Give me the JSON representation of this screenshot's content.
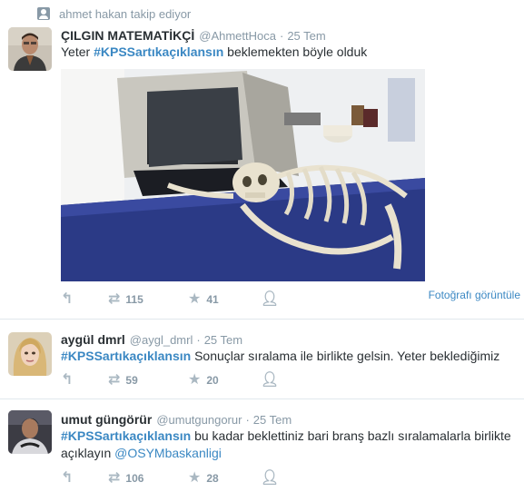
{
  "context": {
    "text": "ahmet hakan takip ediyor",
    "icon": "user-icon"
  },
  "tweets": [
    {
      "fullname": "ÇILGIN MATEMATİKÇİ",
      "username": "@AhmettHoca",
      "time": "25 Tem",
      "hashtag": "#KPSSartıkaçıklansın",
      "text_before": "Yeter ",
      "text_after": " beklemekten böyle olduk",
      "retweets": "115",
      "favorites": "41",
      "photo_link": "Fotoğrafı görüntüle"
    },
    {
      "fullname": "aygül dmrl",
      "username": "@aygl_dmrl",
      "time": "25 Tem",
      "hashtag": "#KPSSartıkaçıklansın",
      "text_after": "  Sonuçlar sıralama ile birlikte gelsin. Yeter beklediğimiz",
      "retweets": "59",
      "favorites": "20"
    },
    {
      "fullname": "umut güngörür",
      "username": "@umutgungorur",
      "time": "25 Tem",
      "hashtag": "#KPSSartıkaçıklansın",
      "text_after": "  bu kadar beklettiniz bari branş bazlı sıralamalarla birlikte",
      "line2_before": "açıklayın ",
      "mention": "@OSYMbaskanligi",
      "retweets": "106",
      "favorites": "28"
    }
  ],
  "icons": {
    "reply": "reply-icon",
    "retweet": "retweet-icon",
    "favorite": "star-icon",
    "follow": "follow-icon"
  },
  "colors": {
    "link": "#3b88c3",
    "muted": "#8899a6",
    "divider": "#e1e8ed"
  }
}
